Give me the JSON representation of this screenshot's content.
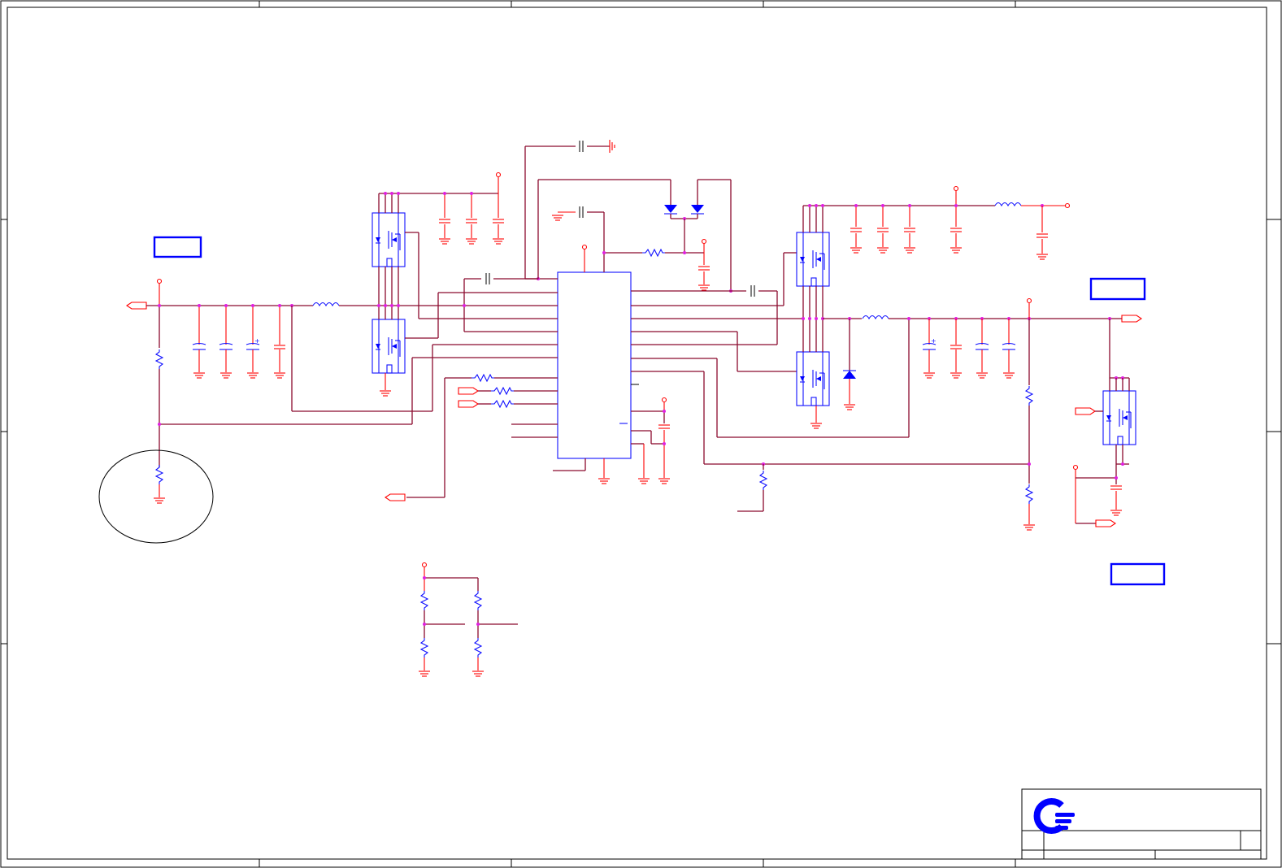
{
  "title_block": {
    "logo": "company-logo-icon",
    "title": "",
    "sheet": ""
  },
  "colors": {
    "wire": "#8B0A2E",
    "power": "#FF0000",
    "component": "#1010FF",
    "frame": "#000000",
    "junction": "#E020E0",
    "logo_primary": "#0000FF"
  },
  "annotations": {
    "box_left": "",
    "box_right_top": "",
    "box_right_bottom": ""
  }
}
